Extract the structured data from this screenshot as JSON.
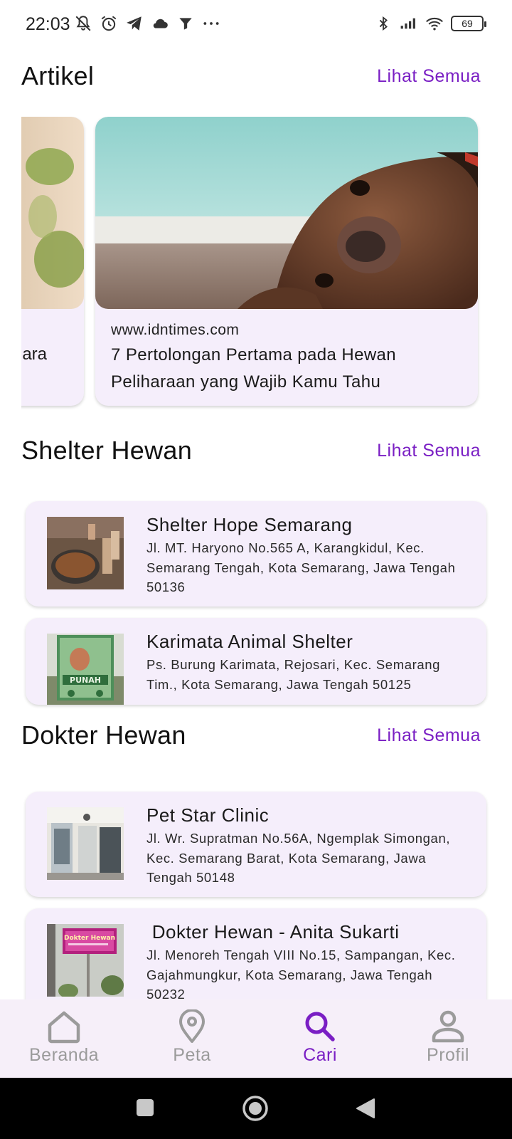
{
  "status_bar": {
    "time": "22:03",
    "battery": "69"
  },
  "sections": {
    "artikel": {
      "title": "Artikel",
      "see_all": "Lihat Semua"
    },
    "shelter": {
      "title": "Shelter Hewan",
      "see_all": "Lihat Semua"
    },
    "dokter": {
      "title": "Dokter Hewan",
      "see_all": "Lihat Semua"
    }
  },
  "articles": [
    {
      "partial_text": "ara"
    },
    {
      "source": "www.idntimes.com",
      "title": "7 Pertolongan Pertama pada Hewan Peliharaan yang Wajib Kamu Tahu"
    }
  ],
  "shelters": [
    {
      "name": "Shelter Hope Semarang",
      "address": "Jl. MT. Haryono No.565 A, Karangkidul, Kec. Semarang Tengah, Kota Semarang, Jawa Tengah 50136"
    },
    {
      "name": "Karimata Animal Shelter",
      "address": "Ps. Burung Karimata, Rejosari, Kec. Semarang Tim., Kota Semarang, Jawa Tengah 50125",
      "sign_text": "PUNAH"
    }
  ],
  "vets": [
    {
      "name": "Pet Star Clinic",
      "address": "Jl. Wr. Supratman No.56A, Ngemplak Simongan, Kec. Semarang Barat, Kota Semarang, Jawa Tengah 50148"
    },
    {
      "name": " Dokter Hewan - Anita Sukarti",
      "address": "Jl. Menoreh Tengah VIII No.15, Sampangan, Kec. Gajahmungkur, Kota Semarang, Jawa Tengah 50232",
      "sign_text": "Dokter Hewan"
    }
  ],
  "bottom_nav": [
    {
      "label": "Beranda",
      "icon": "home-icon",
      "active": false
    },
    {
      "label": "Peta",
      "icon": "map-pin-icon",
      "active": false
    },
    {
      "label": "Cari",
      "icon": "search-icon",
      "active": true
    },
    {
      "label": "Profil",
      "icon": "person-icon",
      "active": false
    }
  ],
  "colors": {
    "accent": "#7a1fc4",
    "card_bg": "#f5eefb",
    "nav_bg": "#f6eff9",
    "inactive": "#9b9b9b"
  }
}
